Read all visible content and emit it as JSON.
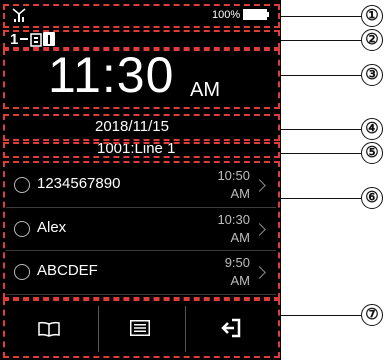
{
  "status": {
    "signal_icon": "antenna-signal",
    "battery_percent": "100%"
  },
  "line_indicator": "1",
  "clock": {
    "time": "11:30",
    "ampm": "AM"
  },
  "date": "2018/11/15",
  "line_name": "1001:Line 1",
  "calls": [
    {
      "name": "1234567890",
      "time": "10:50",
      "ampm": "AM"
    },
    {
      "name": "Alex",
      "time": "10:30",
      "ampm": "AM"
    },
    {
      "name": "ABCDEF",
      "time": "9:50",
      "ampm": "AM"
    }
  ],
  "softkeys": [
    {
      "icon": "book-icon"
    },
    {
      "icon": "menu-list-icon"
    },
    {
      "icon": "logout-icon"
    }
  ],
  "callouts": [
    "①",
    "②",
    "③",
    "④",
    "⑤",
    "⑥",
    "⑦"
  ],
  "colors": {
    "dash": "#e03c3c",
    "screen_bg": "#000000"
  }
}
